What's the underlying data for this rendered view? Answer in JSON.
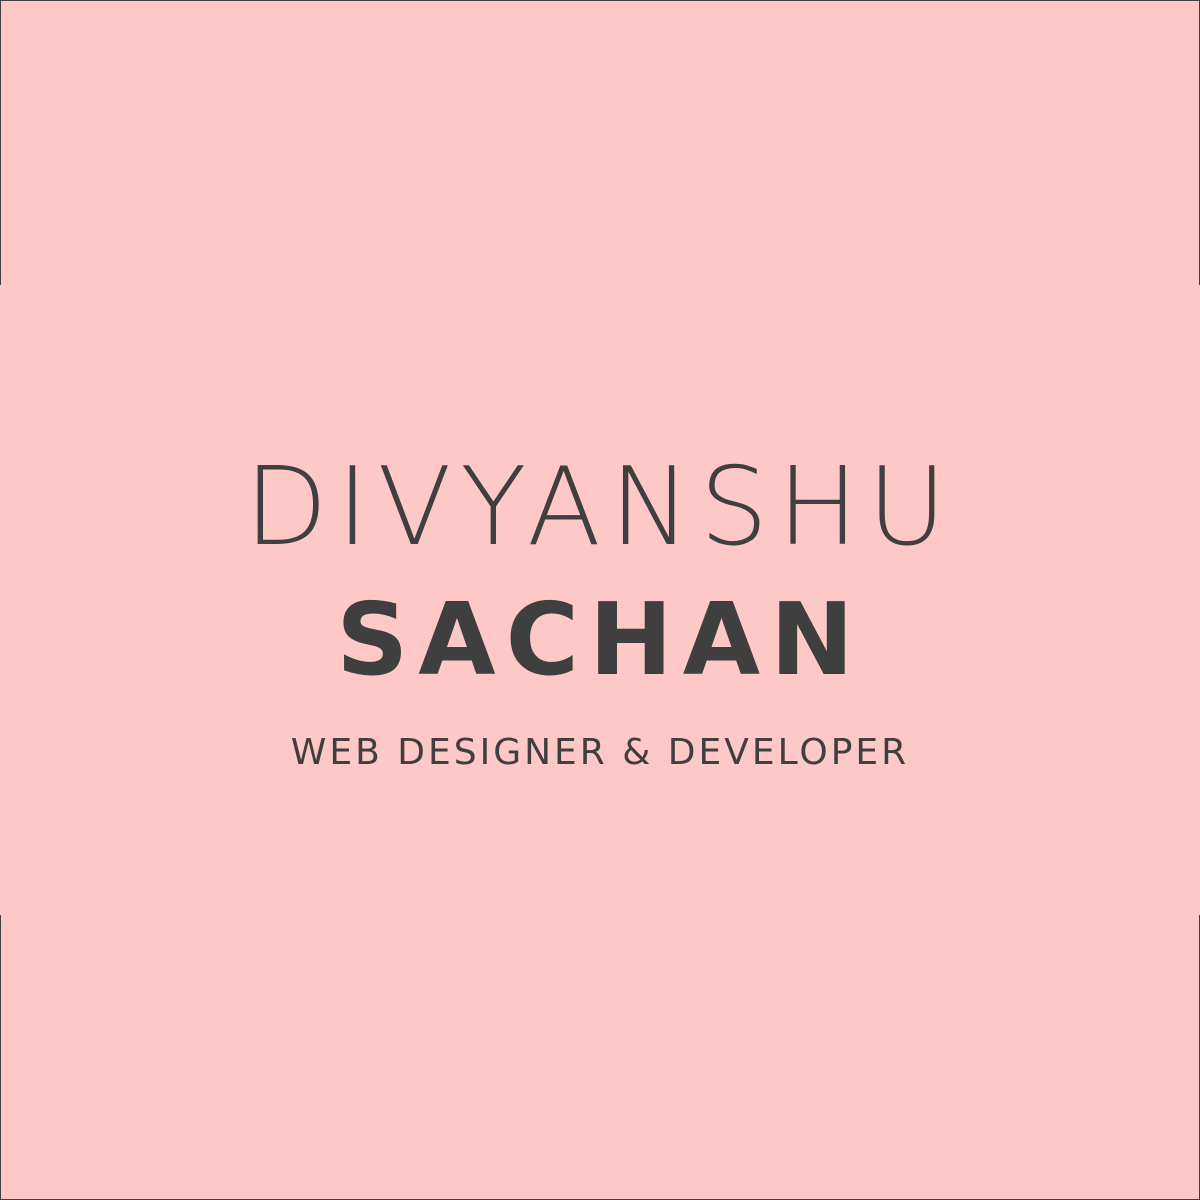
{
  "brand": {
    "first_name": "DIVYANSHU",
    "last_name": "SACHAN",
    "tagline": "WEB DESIGNER & DEVELOPER"
  },
  "colors": {
    "background": "#fdc8c5",
    "text": "#3f3f3f"
  }
}
